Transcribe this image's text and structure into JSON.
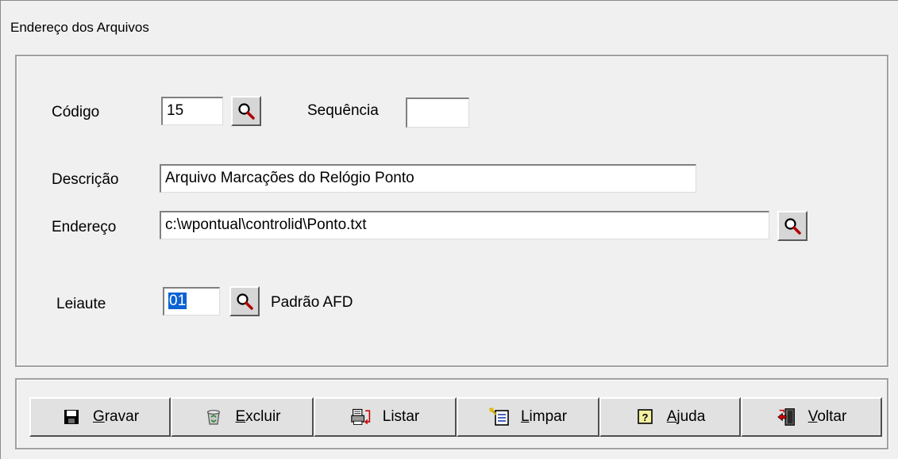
{
  "window": {
    "title": "Endereço dos Arquivos"
  },
  "form": {
    "codigo": {
      "label": "Código",
      "value": "15"
    },
    "sequencia": {
      "label": "Sequência",
      "value": ""
    },
    "descricao": {
      "label": "Descrição",
      "value": "Arquivo Marcações do Relógio Ponto"
    },
    "endereco": {
      "label": "Endereço",
      "value": "c:\\wpontual\\controlid\\Ponto.txt"
    },
    "leiaute": {
      "label": "Leiaute",
      "value": "01",
      "description": "Padrão AFD"
    }
  },
  "toolbar": {
    "buttons": [
      {
        "label": "Gravar",
        "icon": "floppy-disk-icon"
      },
      {
        "label": "Excluir",
        "icon": "recycle-bin-icon"
      },
      {
        "label": "Listar",
        "icon": "printer-icon"
      },
      {
        "label": "Limpar",
        "icon": "clear-document-icon"
      },
      {
        "label": "Ajuda",
        "icon": "help-icon"
      },
      {
        "label": "Voltar",
        "icon": "exit-door-icon"
      }
    ]
  },
  "colors": {
    "background": "#f0f0f0",
    "selection": "#0a62d3"
  }
}
